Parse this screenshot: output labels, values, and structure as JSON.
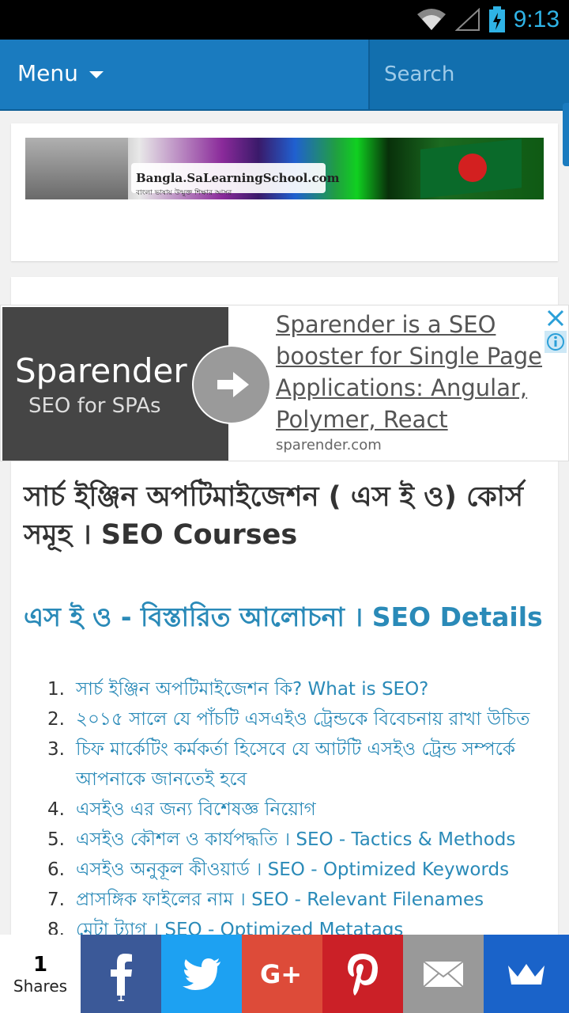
{
  "status_bar": {
    "time": "9:13",
    "wifi_icon": "wifi-icon",
    "signal_icon": "signal-icon",
    "battery_icon": "battery-charging-icon"
  },
  "navbar": {
    "menu_label": "Menu",
    "search_placeholder": "Search"
  },
  "banner": {
    "site_name": "Bangla.SaLearningSchool.com",
    "tagline": "বাংলা ভাষায় উন্মুক্ত শিক্ষার আসর"
  },
  "ad": {
    "brand": "Sparender",
    "tagline": "SEO for SPAs",
    "headline": "Sparender is a SEO booster for Single Page Applications: Angular, Polymer, React",
    "domain": "sparender.com"
  },
  "article": {
    "title": "সার্চ ইঞ্জিন অপটিমাইজেশন ( এস ই ও) কোর্স সমূহ । SEO Courses",
    "section_title": "এস ই ও - বিস্তারিত আলোচনা । SEO Details",
    "items": [
      {
        "num": "1.",
        "text": "সার্চ ইঞ্জিন অপটিমাইজেশন কি? What is SEO?"
      },
      {
        "num": "2.",
        "text": "২০১৫ সালে যে পাঁচটি এসএইও ট্রেন্ডকে বিবেচনায় রাখা উচিত"
      },
      {
        "num": "3.",
        "text": "চিফ মার্কেটিং কর্মকর্তা হিসেবে যে আটটি এসইও ট্রেন্ড সম্পর্কে আপনাকে জানতেই হবে"
      },
      {
        "num": "4.",
        "text": "এসইও এর জন্য বিশেষজ্ঞ নিয়োগ"
      },
      {
        "num": "5.",
        "text": "এসইও কৌশল ও কার্যপদ্ধতি । SEO - Tactics & Methods"
      },
      {
        "num": "6.",
        "text": "এসইও অনুকূল কীওয়ার্ড । SEO - Optimized Keywords"
      },
      {
        "num": "7.",
        "text": "প্রাসঙ্গিক ফাইলের নাম । SEO - Relevant Filenames"
      },
      {
        "num": "8.",
        "text": "মেটা ট্যাগ । SEO - Optimized Metatags"
      }
    ]
  },
  "share_bar": {
    "count": "1",
    "count_label": "Shares",
    "facebook_count": "1"
  }
}
